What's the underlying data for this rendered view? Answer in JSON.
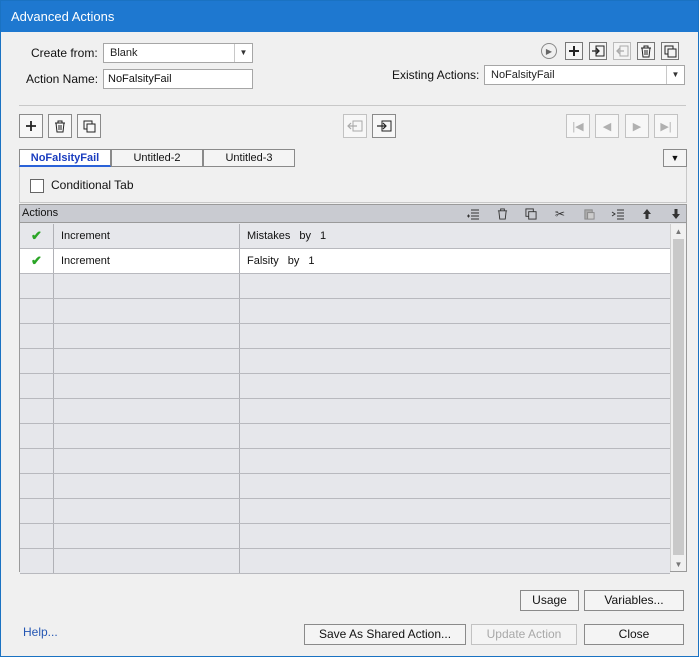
{
  "window": {
    "title": "Advanced Actions"
  },
  "form": {
    "create_from_label": "Create from:",
    "create_from_value": "Blank",
    "action_name_label": "Action Name:",
    "action_name_value": "NoFalsityFail",
    "existing_actions_label": "Existing Actions:",
    "existing_actions_value": "NoFalsityFail"
  },
  "tabs": [
    {
      "label": "NoFalsityFail",
      "active": true
    },
    {
      "label": "Untitled-2",
      "active": false
    },
    {
      "label": "Untitled-3",
      "active": false
    }
  ],
  "conditional": {
    "label": "Conditional Tab",
    "checked": false
  },
  "grid": {
    "header": "Actions",
    "rows": [
      {
        "status": "✔",
        "action": "Increment",
        "target": "Mistakes",
        "by": "by",
        "amount": "1"
      },
      {
        "status": "✔",
        "action": "Increment",
        "target": "Falsity",
        "by": "by",
        "amount": "1"
      }
    ]
  },
  "buttons": {
    "usage": "Usage",
    "variables": "Variables...",
    "save_shared": "Save As Shared Action...",
    "update": "Update Action",
    "close": "Close",
    "help": "Help..."
  },
  "icons": {
    "add": "add-icon",
    "delete": "trash-icon",
    "duplicate": "duplicate-icon",
    "preview": "play-icon"
  },
  "colors": {
    "title_bar": "#1e78d0",
    "active_tab": "#1a3dbf",
    "check": "#2aa526"
  }
}
